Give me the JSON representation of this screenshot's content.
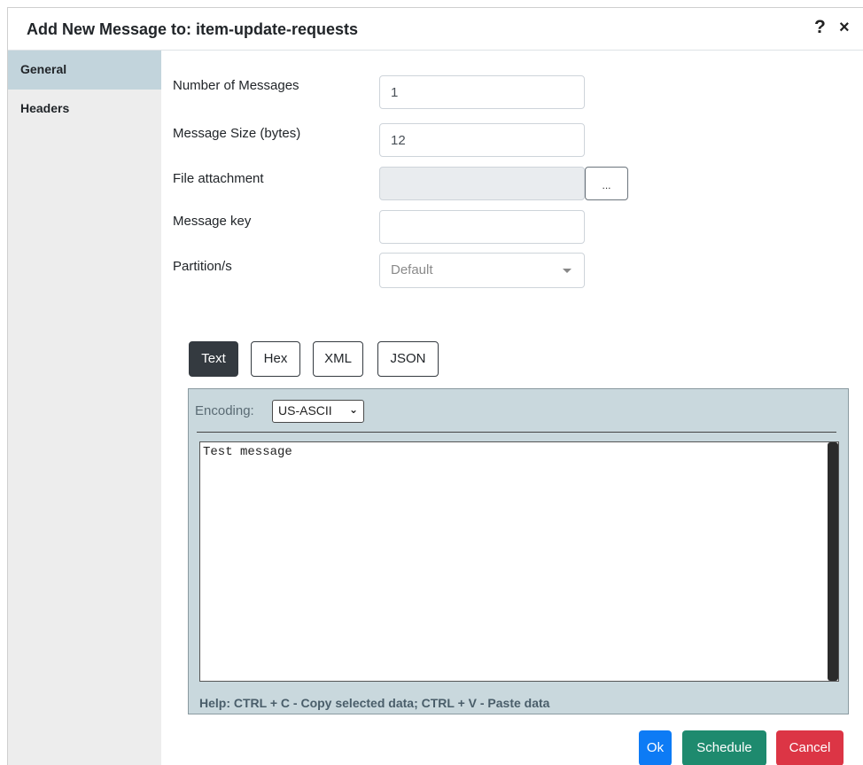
{
  "dialog": {
    "title": "Add New Message to: item-update-requests",
    "help_icon": "?",
    "close_icon": "×"
  },
  "sidebar": {
    "items": [
      {
        "label": "General",
        "active": true
      },
      {
        "label": "Headers",
        "active": false
      }
    ]
  },
  "form": {
    "number_of_messages": {
      "label": "Number of Messages",
      "value": "1"
    },
    "message_size": {
      "label": "Message Size (bytes)",
      "value": "12"
    },
    "file_attachment": {
      "label": "File attachment",
      "value": "",
      "browse_label": "..."
    },
    "message_key": {
      "label": "Message key",
      "value": ""
    },
    "partitions": {
      "label": "Partition/s",
      "value": "Default"
    }
  },
  "format_tabs": [
    {
      "label": "Text",
      "active": true
    },
    {
      "label": "Hex",
      "active": false
    },
    {
      "label": "XML",
      "active": false
    },
    {
      "label": "JSON",
      "active": false
    }
  ],
  "editor": {
    "encoding_label": "Encoding:",
    "encoding_value": "US-ASCII",
    "content": "Test message",
    "help": "Help: CTRL + C - Copy selected data; CTRL + V - Paste data"
  },
  "actions": {
    "ok": "Ok",
    "schedule": "Schedule",
    "cancel": "Cancel"
  },
  "colors": {
    "active_sidebar": "#c2d4dc",
    "editor_panel": "#c9d8dd",
    "ok": "#0d7bf5",
    "schedule": "#1e8a6e",
    "cancel": "#dc3545"
  }
}
